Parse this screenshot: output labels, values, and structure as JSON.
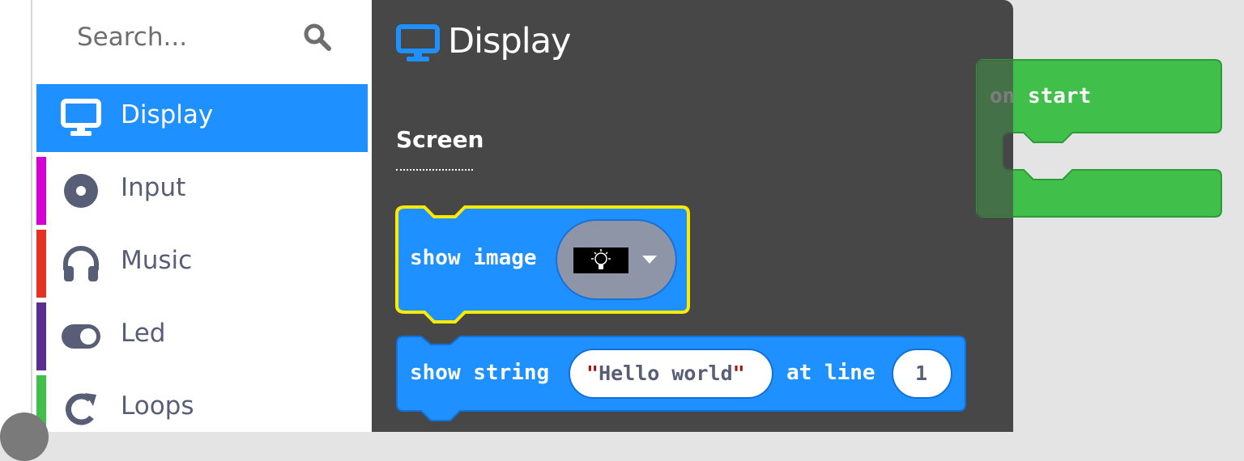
{
  "search": {
    "placeholder": "Search..."
  },
  "categories": [
    {
      "label": "Display",
      "color": "#1e90ff",
      "icon": "monitor-icon",
      "selected": true
    },
    {
      "label": "Input",
      "color": "#d400d4",
      "icon": "circle-dot-icon"
    },
    {
      "label": "Music",
      "color": "#e63022",
      "icon": "headphones-icon"
    },
    {
      "label": "Led",
      "color": "#5c2d91",
      "icon": "toggle-icon"
    },
    {
      "label": "Loops",
      "color": "#40bf4a",
      "icon": "loop-arrow-icon"
    }
  ],
  "flyout": {
    "title": "Display",
    "section": "Screen",
    "blocks": {
      "show_image": {
        "label": "show image",
        "dropdown_value": "lightbulb-icon",
        "highlight_color": "#ffea00"
      },
      "show_string": {
        "label_before": "show string",
        "string_value": "Hello world",
        "label_middle": "at line",
        "line_value": "1"
      }
    }
  },
  "workspace": {
    "on_start": {
      "label_prefix": "on",
      "label": "start",
      "color": "#40bf4a"
    }
  }
}
